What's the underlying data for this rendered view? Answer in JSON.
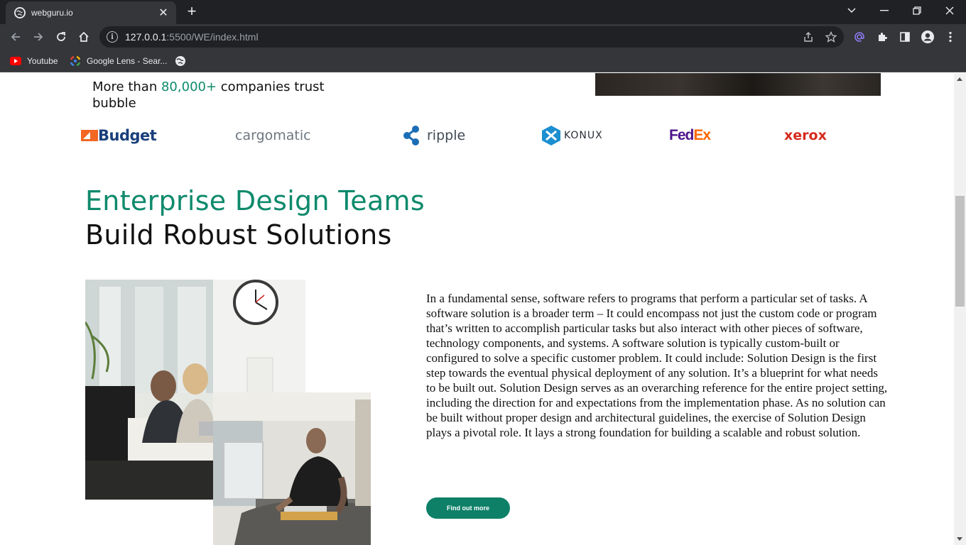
{
  "browser": {
    "tab_title": "webguru.io",
    "tab_close": "✕",
    "new_tab": "+",
    "url_host": "127.0.0.1",
    "url_rest": ":5500/WE/index.html",
    "bookmarks": [
      {
        "label": "Youtube",
        "icon": "youtube-icon"
      },
      {
        "label": "Google Lens - Sear...",
        "icon": "google-lens-icon"
      },
      {
        "label": "",
        "icon": "globe-icon"
      }
    ]
  },
  "page": {
    "trust_prefix": "More than ",
    "trust_count": "80,000+",
    "trust_suffix": " companies trust bubble",
    "logos": [
      {
        "text": "Budget",
        "color": "#1a3f7a"
      },
      {
        "text": "cargomatic",
        "color": "#6d7680"
      },
      {
        "text": "ripple",
        "color": "#404a56"
      },
      {
        "text": "KONUX",
        "color": "#2a2f36"
      },
      {
        "text_fed": "Fed",
        "text_ex": "Ex",
        "color_fed": "#4d148c",
        "color_ex": "#ff6600"
      },
      {
        "text": "xerox",
        "color": "#d52b1e"
      }
    ],
    "heading_line1": "Enterprise Design Teams",
    "heading_line2": "Build Robust Solutions",
    "body": "In a fundamental sense, software refers to programs that perform a particular set of tasks. A software solution is a broader term – It could encompass not just the custom code or program that’s written to accomplish particular tasks but also interact with other pieces of software, technology components, and systems. A software solution is typically custom-built or configured to solve a specific customer problem. It could include: Solution Design is the first step towards the eventual physical deployment of any solution. It’s a blueprint for what needs to be built out. Solution Design serves as an overarching reference for the entire project setting, including the direction for and expectations from the implementation phase. As no solution can be built without proper design and architectural guidelines, the exercise of Solution Design plays a pivotal role. It lays a strong foundation for building a scalable and robust solution.",
    "cta_label": "Find out more"
  },
  "colors": {
    "accent": "#0e8a6c",
    "button": "#0e8068",
    "chrome_dark": "#202124",
    "chrome_mid": "#35363a"
  }
}
